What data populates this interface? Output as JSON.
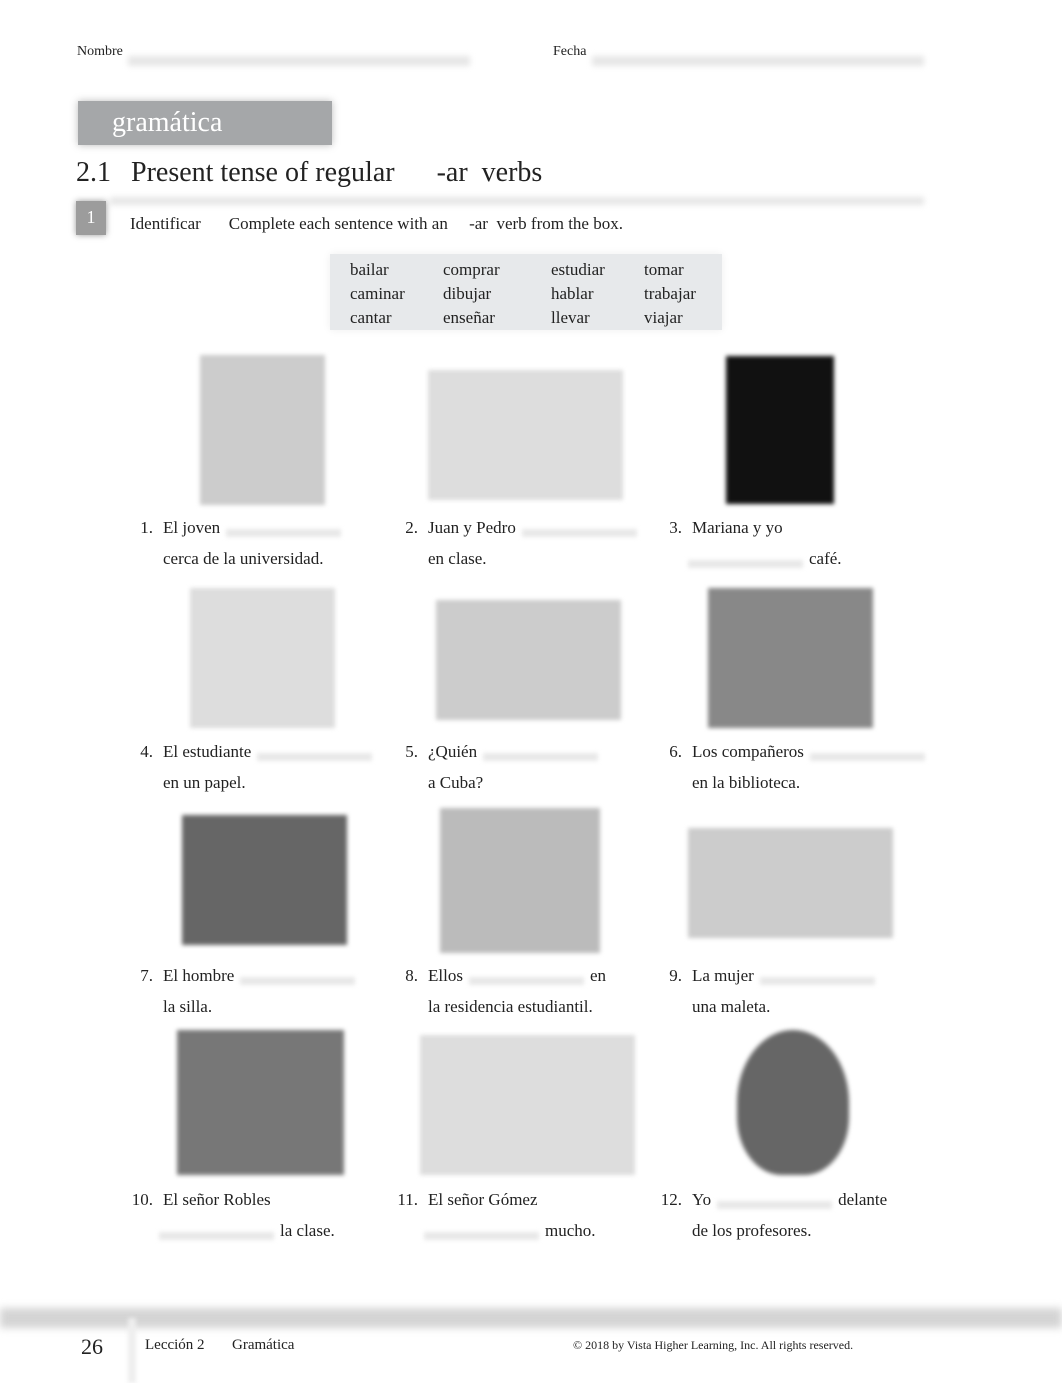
{
  "header": {
    "name_label": "Nombre",
    "date_label": "Fecha"
  },
  "banner": "gramática",
  "section": {
    "number": "2.1",
    "title": "Present tense of regular",
    "suffix": "-ar",
    "verbs": "verbs"
  },
  "activity": {
    "number": "1",
    "name": "Identificar",
    "instruction_a": "Complete each sentence with an",
    "instruction_b": "-ar",
    "instruction_c": "verb from the box."
  },
  "verb_box": [
    [
      "bailar",
      "caminar",
      "cantar"
    ],
    [
      "comprar",
      "dibujar",
      "enseñar"
    ],
    [
      "estudiar",
      "hablar",
      "llevar"
    ],
    [
      "tomar",
      "trabajar",
      "viajar"
    ]
  ],
  "items": [
    {
      "n": "1.",
      "a": "El joven",
      "b": "",
      "c": "cerca de la universidad."
    },
    {
      "n": "2.",
      "a": "Juan y Pedro",
      "b": "",
      "c": "en clase."
    },
    {
      "n": "3.",
      "a": "Mariana y yo",
      "b": "",
      "c": "café."
    },
    {
      "n": "4.",
      "a": "El estudiante",
      "b": "",
      "c": "en un papel."
    },
    {
      "n": "5.",
      "a": "¿Quién",
      "b": "",
      "c": "a Cuba?"
    },
    {
      "n": "6.",
      "a": "Los compañeros",
      "b": "",
      "c": "en la biblioteca."
    },
    {
      "n": "7.",
      "a": "El hombre",
      "b": "",
      "c": "la silla."
    },
    {
      "n": "8.",
      "a": "Ellos",
      "b": "en",
      "c": "la residencia estudiantil."
    },
    {
      "n": "9.",
      "a": "La mujer",
      "b": "",
      "c": "una maleta."
    },
    {
      "n": "10.",
      "a": "El señor Robles",
      "b": "",
      "c": "la clase."
    },
    {
      "n": "11.",
      "a": "El señor Gómez",
      "b": "",
      "c": "mucho."
    },
    {
      "n": "12.",
      "a": "Yo",
      "b": "delante",
      "c": "de los profesores."
    }
  ],
  "footer": {
    "page": "26",
    "lesson": "Lección 2",
    "section": "Gramática",
    "copyright": "© 2018 by Vista Higher Learning, Inc. All rights reserved."
  }
}
